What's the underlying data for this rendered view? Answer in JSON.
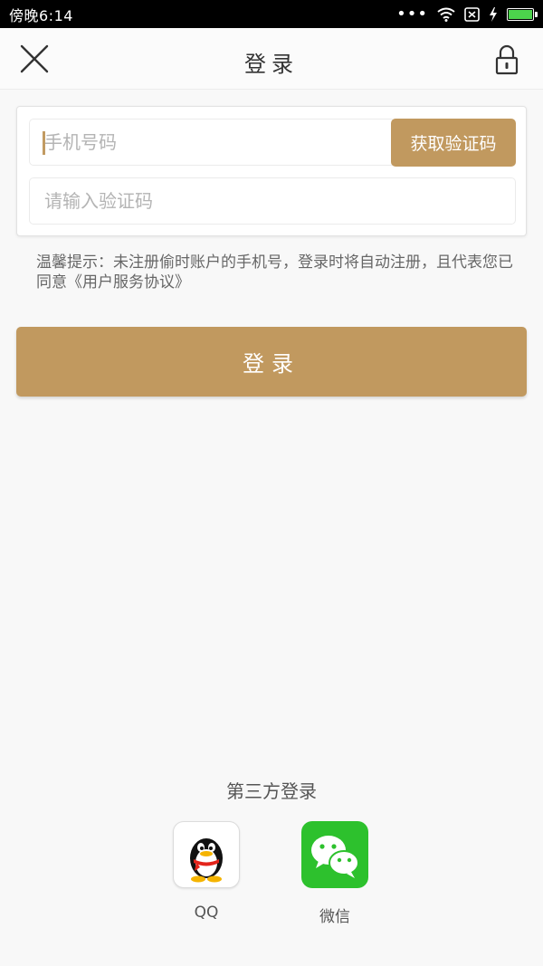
{
  "status_bar": {
    "time": "傍晚6:14",
    "signal_dots": "•••",
    "battery_color": "#4cd34c"
  },
  "nav": {
    "title": "登录",
    "close_icon": "close-icon",
    "lock_icon": "lock-icon"
  },
  "form": {
    "phone_placeholder": "手机号码",
    "phone_value": "",
    "get_code_label": "获取验证码",
    "code_placeholder": "请输入验证码",
    "code_value": ""
  },
  "tip": "温馨提示：未注册偷时账户的手机号，登录时将自动注册，且代表您已同意《用户服务协议》",
  "login_label": "登录",
  "third_party": {
    "title": "第三方登录",
    "items": [
      {
        "label": "QQ",
        "icon": "qq-icon"
      },
      {
        "label": "微信",
        "icon": "wechat-icon"
      }
    ]
  },
  "colors": {
    "accent": "#c1995f",
    "wechat_green": "#2dc12d"
  }
}
